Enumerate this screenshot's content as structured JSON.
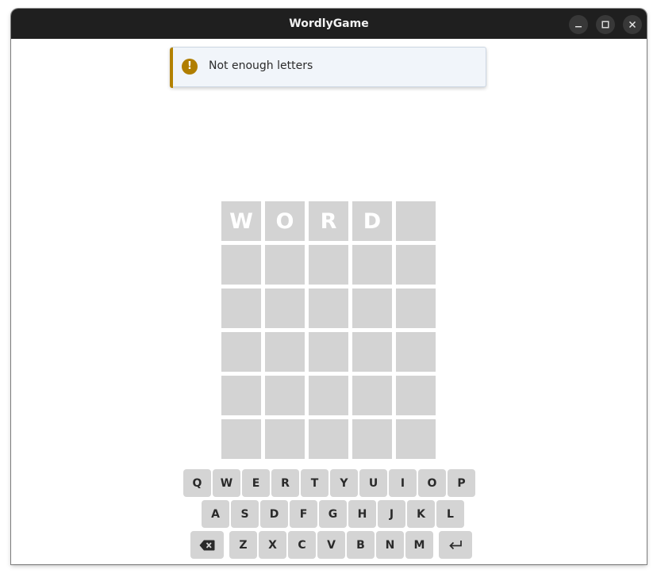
{
  "window": {
    "title": "WordlyGame",
    "controls": [
      "minimize-icon",
      "maximize-icon",
      "close-icon"
    ]
  },
  "toast": {
    "icon": "warning-icon",
    "message": "Not enough letters",
    "accent_color": "#b28100"
  },
  "board": {
    "rows": [
      [
        "W",
        "O",
        "R",
        "D",
        ""
      ],
      [
        "",
        "",
        "",
        "",
        ""
      ],
      [
        "",
        "",
        "",
        "",
        ""
      ],
      [
        "",
        "",
        "",
        "",
        ""
      ],
      [
        "",
        "",
        "",
        "",
        ""
      ],
      [
        "",
        "",
        "",
        "",
        ""
      ]
    ],
    "tile_color": "#d3d3d3"
  },
  "keyboard": {
    "row1": [
      "Q",
      "W",
      "E",
      "R",
      "T",
      "Y",
      "U",
      "I",
      "O",
      "P"
    ],
    "row2": [
      "A",
      "S",
      "D",
      "F",
      "G",
      "H",
      "J",
      "K",
      "L"
    ],
    "row3": [
      "Z",
      "X",
      "C",
      "V",
      "B",
      "N",
      "M"
    ],
    "backspace_icon": "backspace-icon",
    "enter_icon": "enter-icon",
    "key_color": "#d4d4d4"
  }
}
